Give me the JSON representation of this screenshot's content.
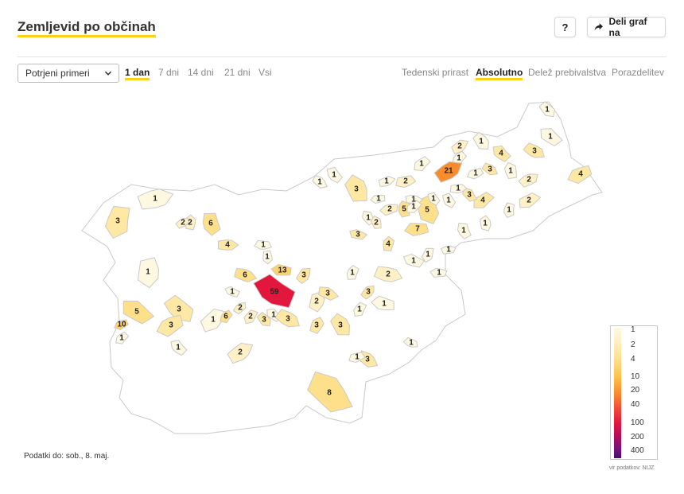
{
  "header": {
    "title": "Zemljevid po občinah",
    "help_label": "?",
    "share_label": "Deli graf na"
  },
  "controls": {
    "dropdown_value": "Potrjeni primeri",
    "time_tabs": [
      "1 dan",
      "7 dni",
      "14 dni",
      "21 dni",
      "Vsi"
    ],
    "active_time_tab": "1 dan",
    "view_tabs": [
      "Tedenski prirast",
      "Absolutno",
      "Delež prebivalstva",
      "Porazdelitev"
    ],
    "active_view_tab": "Absolutno"
  },
  "map": {
    "metric": "Potrjeni primeri",
    "period": "1 dan",
    "municipality_values": [
      1,
      1,
      3,
      4,
      2,
      1,
      1,
      4,
      3,
      1,
      21,
      1,
      3,
      1,
      1,
      2,
      2,
      4,
      1,
      1,
      3,
      1,
      2,
      2,
      5,
      5,
      1,
      4,
      1,
      1,
      1,
      1,
      1,
      1,
      7,
      1,
      3,
      2,
      6,
      3,
      1,
      1,
      1,
      4,
      1,
      1,
      2,
      1,
      3,
      1,
      1,
      1,
      6,
      13,
      3,
      1,
      2,
      59,
      3,
      1,
      2,
      2,
      3,
      3,
      5,
      1,
      3,
      1,
      6,
      3,
      1,
      3,
      10,
      2,
      1,
      3,
      1,
      3,
      1,
      2,
      1,
      2,
      1,
      8
    ],
    "colors": {
      "1": "#fff8e1",
      "2": "#fff1c5",
      "3-4": "#ffe8a3",
      "5-9": "#ffe08a",
      "10-19": "#ffd36b",
      "20-39": "#fb8c2c",
      "40-99": "#e3173e",
      "none": "#ffffff"
    }
  },
  "legend": {
    "ticks": [
      "1",
      "2",
      "4",
      "10",
      "20",
      "40",
      "100",
      "200",
      "400"
    ],
    "source": "vir podatkov: NIJZ"
  },
  "footer": {
    "data_date": "Podatki do: sob., 8. maj."
  }
}
